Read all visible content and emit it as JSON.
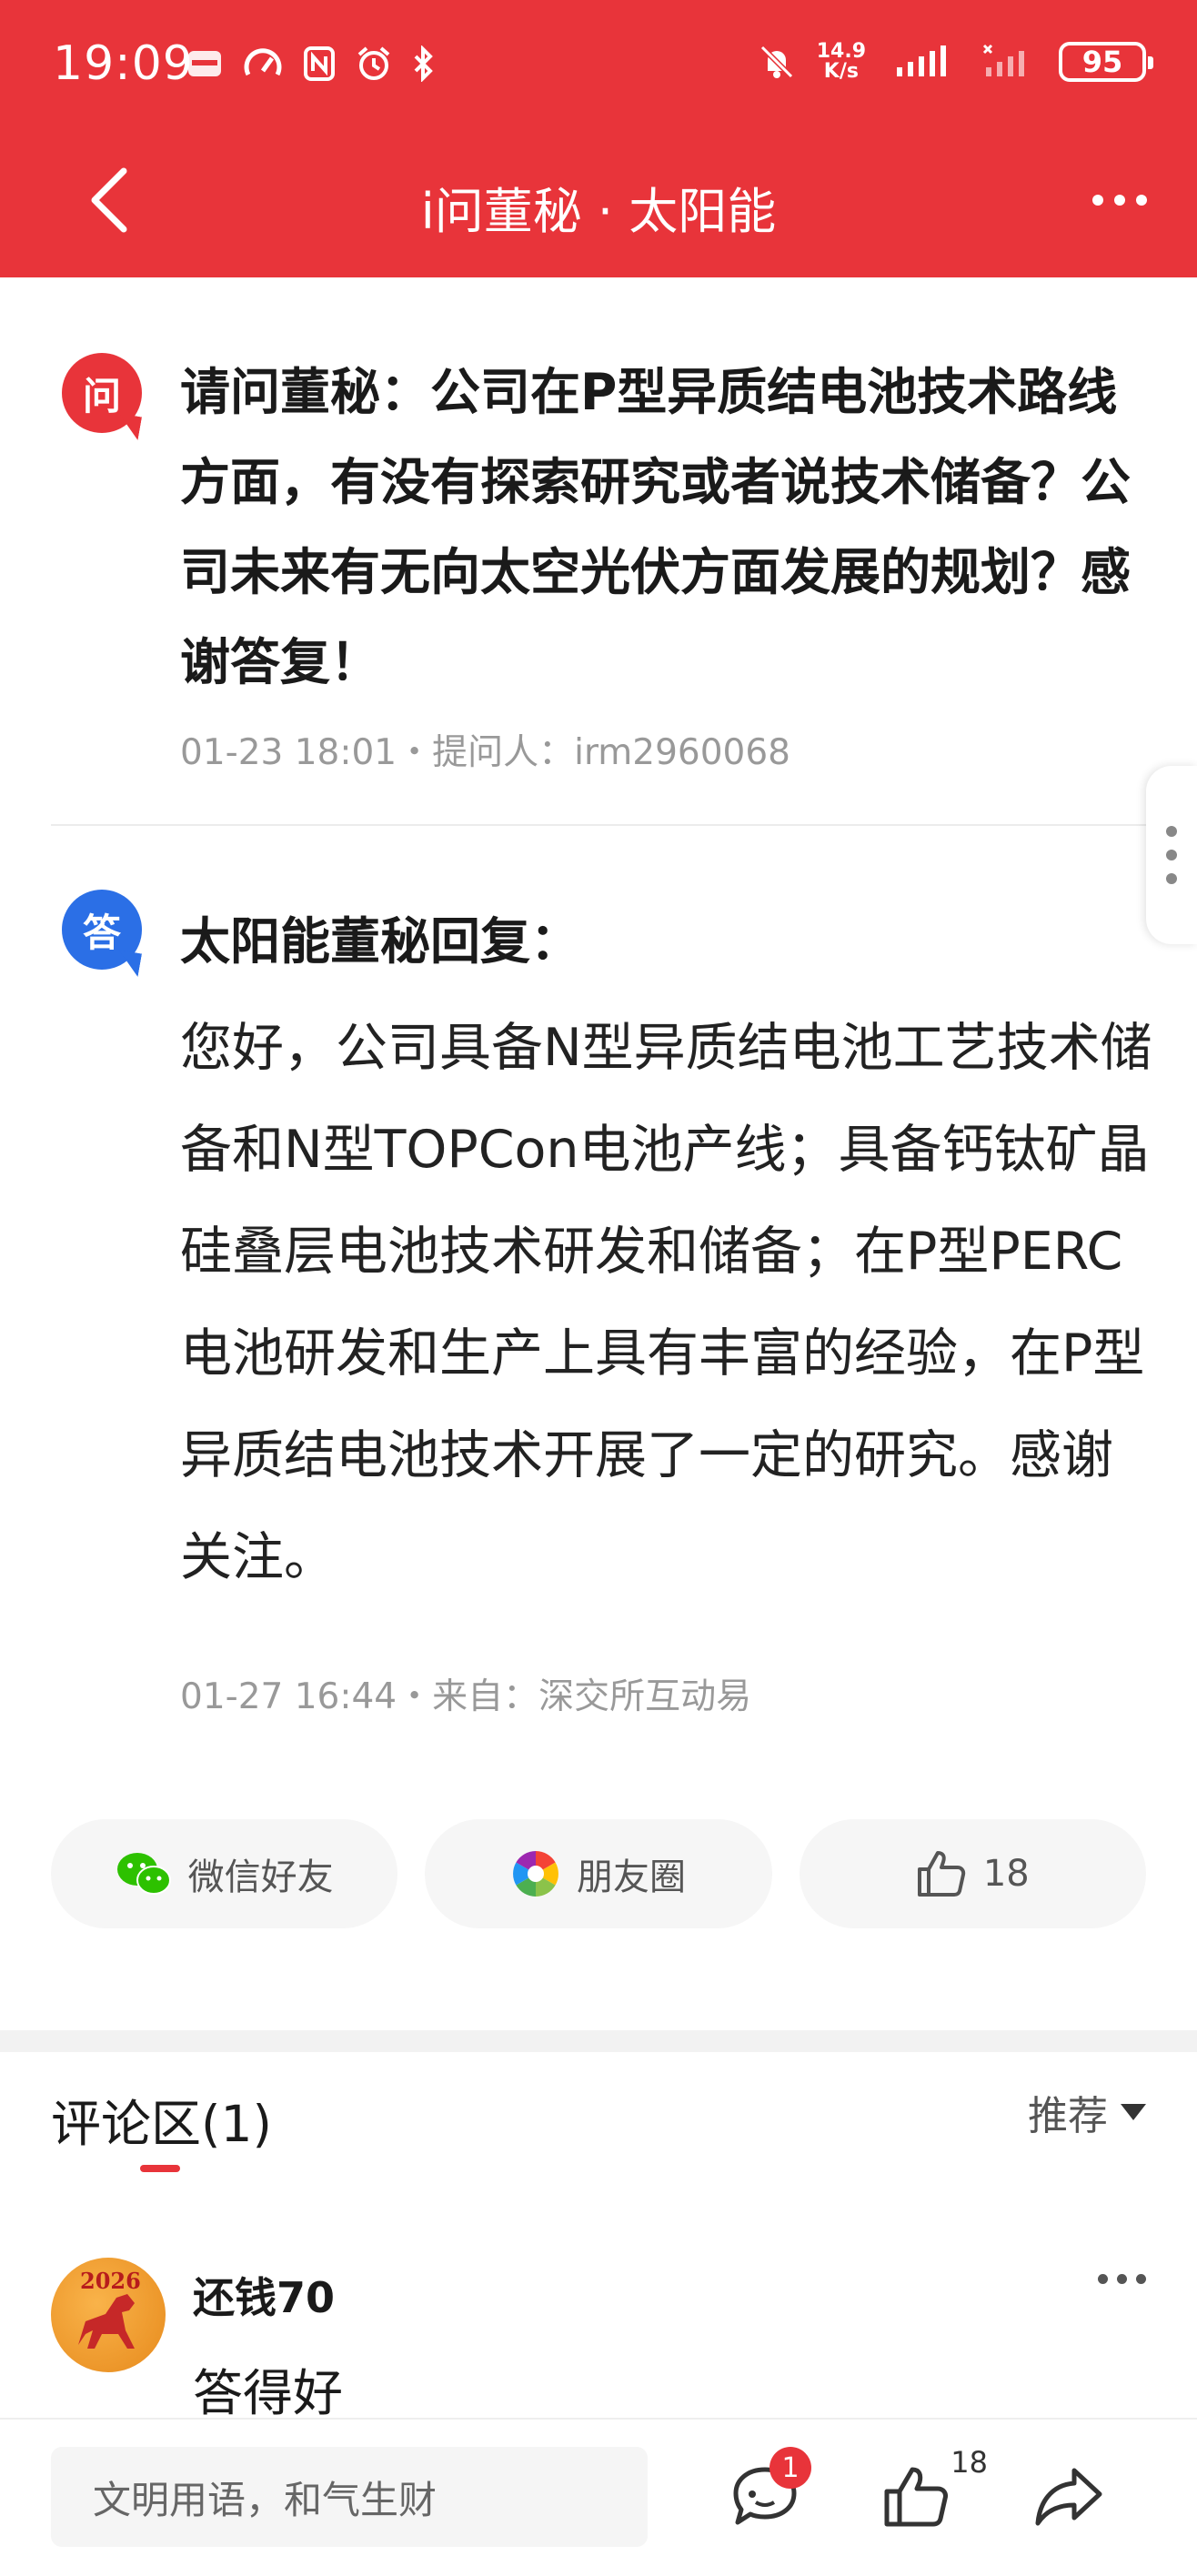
{
  "status_bar": {
    "time": "19:09",
    "network_speed_value": "14.9",
    "network_speed_unit": "K/s",
    "battery": "95"
  },
  "nav": {
    "title": "i问董秘 · 太阳能"
  },
  "question": {
    "badge": "问",
    "text": "请问董秘：公司在P型异质结电池技术路线方面，有没有探索研究或者说技术储备？公司未来有无向太空光伏方面发展的规划？感谢答复！",
    "meta": "01-23 18:01・提问人：irm2960068"
  },
  "answer": {
    "badge": "答",
    "title": "太阳能董秘回复：",
    "text": "您好，公司具备N型异质结电池工艺技术储备和N型TOPCon电池产线；具备钙钛矿晶硅叠层电池技术研发和储备；在P型PERC电池研发和生产上具有丰富的经验，在P型异质结电池技术开展了一定的研究。感谢关注。",
    "meta": "01-27 16:44・来自：深交所互动易"
  },
  "share": {
    "wechat_label": "微信好友",
    "moments_label": "朋友圈",
    "like_count": "18"
  },
  "comments": {
    "title": "评论区(1)",
    "sort_label": "推荐",
    "items": [
      {
        "user": "还钱70",
        "text": "答得好"
      }
    ]
  },
  "bottom_bar": {
    "input_placeholder": "文明用语，和气生财",
    "comment_badge": "1",
    "like_count": "18"
  },
  "colors": {
    "brand_red": "#e8343a",
    "answer_blue": "#2b6fe6"
  }
}
